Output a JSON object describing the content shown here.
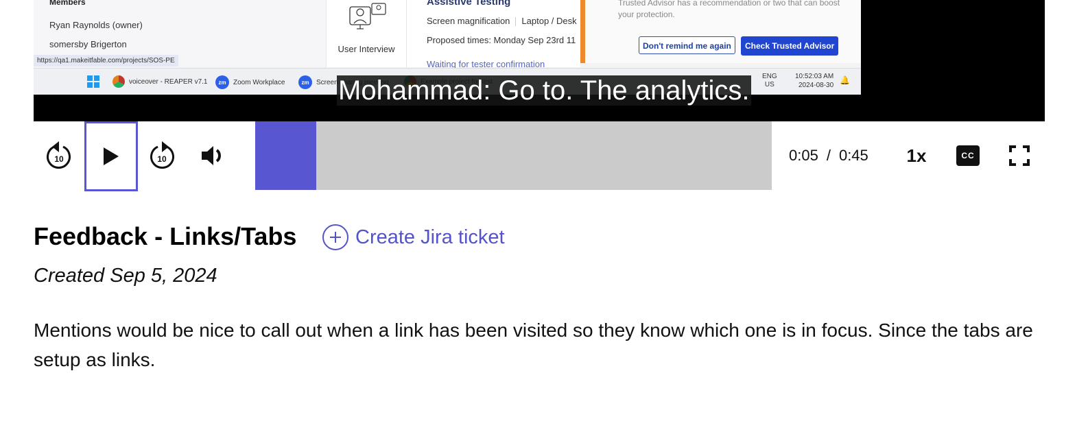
{
  "video": {
    "frame": {
      "members_title": "Members",
      "members": [
        "Ryan Raynolds (owner)",
        "somersby Brigerton"
      ],
      "url_tooltip": "https://qa1.makeitfable.com/projects/SOS-PE",
      "interview_label": "User Interview",
      "assistive_title": "Assistive Testing",
      "assistive_tech": "Screen magnification",
      "device": "Laptop / Desk",
      "proposed_times": "Proposed times: Monday Sep 23rd 11",
      "status": "Waiting for tester confirmation",
      "advisor_text": "Trusted Advisor has a recommendation or two that can boost your protection.",
      "advisor_dont_remind": "Don't remind me again",
      "advisor_check": "Check Trusted Advisor",
      "taskbar": {
        "items": [
          "voiceover - REAPER v7.1",
          "Zoom Workplace",
          "Screen sharing meeting",
          "Example project for test"
        ],
        "lang_1": "ENG",
        "lang_2": "US",
        "time": "10:52:03 AM",
        "date": "2024-08-30"
      }
    },
    "caption": "Mohammad: Go to. The analytics."
  },
  "controls": {
    "rewind_label": "10",
    "forward_label": "10",
    "progress_fraction": 0.118,
    "current_time": "0:05",
    "time_separator": "/",
    "duration": "0:45",
    "speed": "1x",
    "cc_label": "CC",
    "accent_color": "#5856d0",
    "track_color": "#cbcbcb"
  },
  "feedback": {
    "title": "Feedback - Links/Tabs",
    "create_jira": "Create Jira ticket",
    "created": "Created Sep 5, 2024",
    "description": "Mentions would be nice to call out when a link has been visited so they know which one is in focus. Since the tabs are setup as links."
  }
}
